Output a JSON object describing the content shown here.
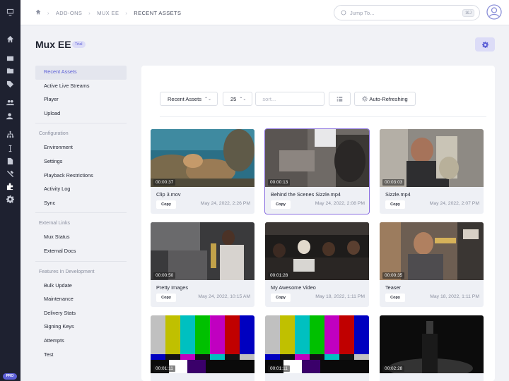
{
  "breadcrumb": {
    "items": [
      "ADD-ONS",
      "MUX EE",
      "RECENT ASSETS"
    ]
  },
  "search": {
    "placeholder": "Jump To...",
    "shortcut": "⌘J"
  },
  "page": {
    "title": "Mux EE",
    "badge": "Trial"
  },
  "subnav": {
    "main": [
      "Recent Assets",
      "Active Live Streams",
      "Player",
      "Upload"
    ],
    "configuration_title": "Configuration",
    "configuration": [
      "Environment",
      "Settings",
      "Playback Restrictions",
      "Activity Log",
      "Sync"
    ],
    "external_title": "External Links",
    "external": [
      "Mux Status",
      "External Docs"
    ],
    "features_title": "Features In Development",
    "features": [
      "Bulk Update",
      "Maintenance",
      "Delivery Stats",
      "Signing Keys",
      "Attempts",
      "Test"
    ]
  },
  "toolbar": {
    "type_select": "Recent Assets",
    "per_page": "25",
    "sort_placeholder": "sort...",
    "refresh_label": "Auto-Refreshing"
  },
  "copy_label": "Copy",
  "assets": [
    {
      "duration": "00:00:37",
      "name": "Clip 3.mov",
      "date": "May 24, 2022, 2:26 PM"
    },
    {
      "duration": "00:00:13",
      "name": "Behind the Scenes Sizzle.mp4",
      "date": "May 24, 2022, 2:08 PM"
    },
    {
      "duration": "00:03:03",
      "name": "Sizzle.mp4",
      "date": "May 24, 2022, 2:07 PM"
    },
    {
      "duration": "00:00:50",
      "name": "Pretty Images",
      "date": "May 24, 2022, 10:15 AM"
    },
    {
      "duration": "00:01:28",
      "name": "My Awesome Video",
      "date": "May 18, 2022, 1:11 PM"
    },
    {
      "duration": "00:00:35",
      "name": "Teaser",
      "date": "May 18, 2022, 1:11 PM"
    },
    {
      "duration": "00:01:11",
      "name": "",
      "date": ""
    },
    {
      "duration": "00:01:11",
      "name": "",
      "date": ""
    },
    {
      "duration": "00:02:28",
      "name": "",
      "date": ""
    }
  ],
  "colors": {
    "accent": "#5c5fd6",
    "rail": "#1e2130",
    "selected_border": "#8a6fe0"
  },
  "badges": {
    "pro": "PRO"
  }
}
